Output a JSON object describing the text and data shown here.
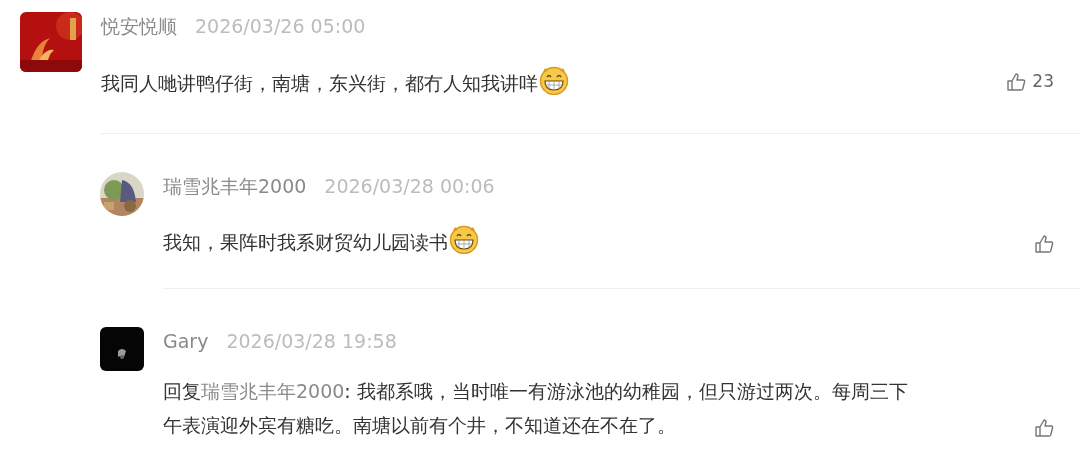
{
  "comments": [
    {
      "author": "悦安悦顺",
      "time": "2026/03/26 05:00",
      "text": "我同人哋讲鸭仔街，南塘，东兴街，都冇人知我讲咩",
      "emoji": true,
      "likes": "23",
      "children": [
        {
          "author": "瑞雪兆丰年2000",
          "time": "2026/03/28 00:06",
          "text": "我知，果阵时我系财贸幼儿园读书",
          "emoji": true
        },
        {
          "author": "Gary",
          "time": "2026/03/28 19:58",
          "reply_prefix": "回复",
          "reply_to": "瑞雪兆丰年2000",
          "text": ": 我都系哦，当时唯一有游泳池的幼稚园，但只游过两次。每周三下午表演迎外宾有糖吃。南塘以前有个井，不知道还在不在了。",
          "emoji": false
        }
      ]
    }
  ]
}
